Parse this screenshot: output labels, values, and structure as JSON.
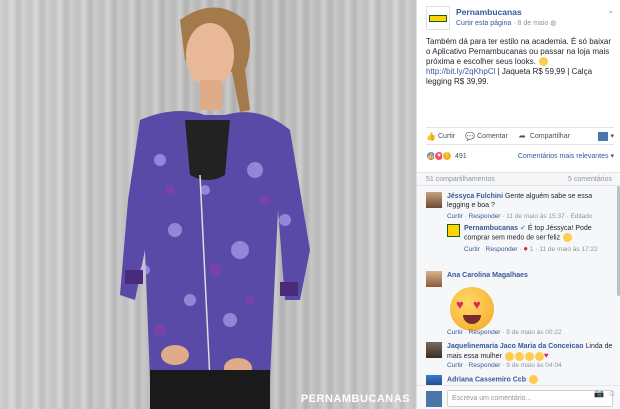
{
  "photo": {
    "watermark": "PERNAMBUCANAS"
  },
  "post": {
    "page_name": "Pernambucanas",
    "follow_label": "Curtir esta página",
    "date": "8 de maio",
    "text_before_link": "Também dá para ter estilo na academia. É só baixar o Aplicativo Pernambucanas ou passar na loja mais próxima e escolher seus looks. ",
    "link": "http://bit.ly/2qKhpCl",
    "text_after_link": " | Jaqueta R$ 59,99 | Calça legging R$ 39,99."
  },
  "actions": {
    "like": "Curtir",
    "comment": "Comentar",
    "share": "Compartilhar"
  },
  "reactions": {
    "count": "491",
    "sort_label": "Comentários mais relevantes"
  },
  "stats": {
    "shares": "51 compartilhamentos",
    "comments": "5 comentários"
  },
  "comments": [
    {
      "name": "Jéssyca Fulchini",
      "text": "Gente alguém sabe se essa legging e boa ?",
      "like": "Curtir",
      "reply": "Responder",
      "time": "11 de maio às 15:37",
      "edited": "Editado"
    },
    {
      "name": "Pernambucanas",
      "text": "É top Jéssyca! Pode comprar sem medo de ser feliz",
      "like": "Curtir",
      "reply": "Responder",
      "likes": "1",
      "time": "11 de maio às 17:22"
    },
    {
      "name": "Ana Carolina Magalhaes",
      "like": "Curtir",
      "reply": "Responder",
      "time": "9 de maio às 00:22"
    },
    {
      "name": "Jaquelinemaria Jaco Maria da Conceicao",
      "text": "Linda de mais essa mulher",
      "like": "Curtir",
      "reply": "Responder",
      "time": "9 de maio às 04:04"
    },
    {
      "name": "Adriana Cassemiro Ccb"
    }
  ],
  "composer": {
    "placeholder": "Escreva um comentário..."
  },
  "colors": {
    "link": "#365899",
    "jacket_purple": "#5a4aa8",
    "brand_yellow": "#ffd400"
  }
}
